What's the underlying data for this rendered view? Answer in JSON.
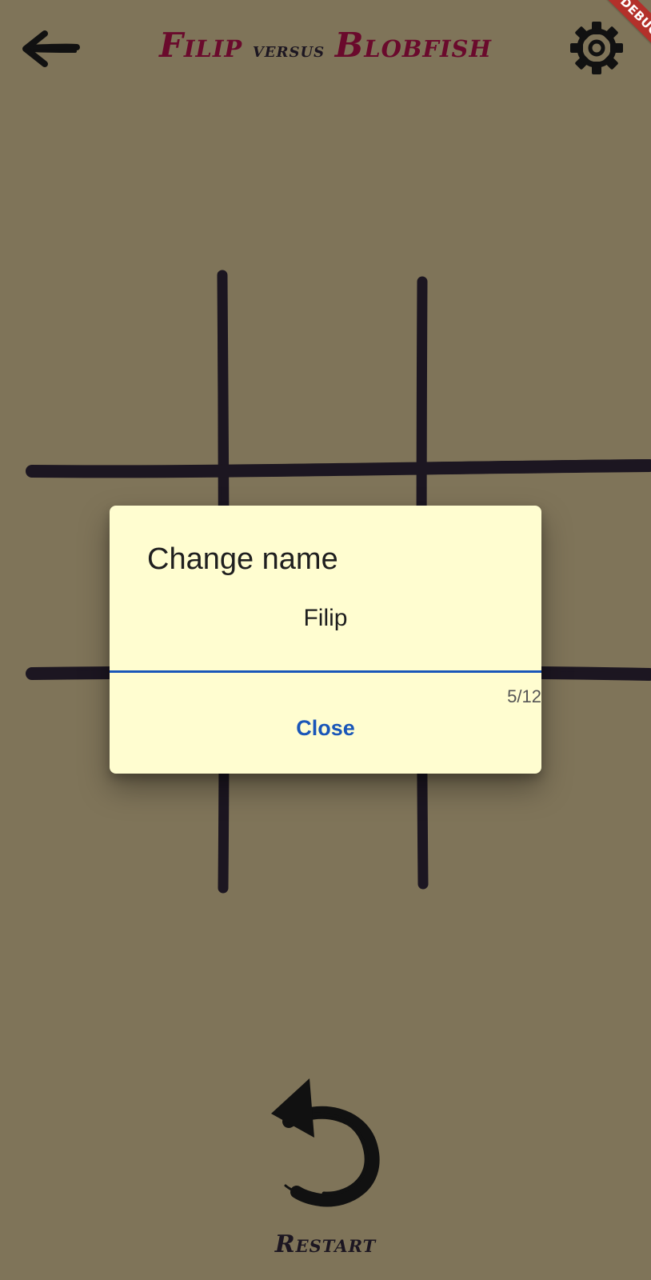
{
  "app": {
    "title": {
      "player_one": "Filip",
      "separator": "versus",
      "player_two": "Blobfish"
    },
    "debug_banner": "DEBUG"
  },
  "header": {
    "back_icon": "arrow-left-icon",
    "settings_icon": "gear-icon"
  },
  "board": {
    "rows": 3,
    "columns": 3,
    "cells": [
      "",
      "",
      "",
      "",
      "",
      "",
      "",
      "",
      ""
    ]
  },
  "dialog": {
    "title": "Change name",
    "name_value": "Filip",
    "char_counter": "5/12",
    "close_label": "Close"
  },
  "footer": {
    "restart_icon": "restart-icon",
    "restart_label": "Restart"
  },
  "colors": {
    "background": "#7f7459",
    "scrim": "rgba(0,0,0,0)",
    "grid_lines": "#1c1621",
    "title_names": "#6a0a2c",
    "title_separator": "#1c1621",
    "icons": "#111111",
    "dialog_background": "#fffdd0",
    "dialog_text": "#1f1f1f",
    "accent": "#1a56b8",
    "counter_text": "#555555",
    "debug_banner": "#b3302a"
  }
}
